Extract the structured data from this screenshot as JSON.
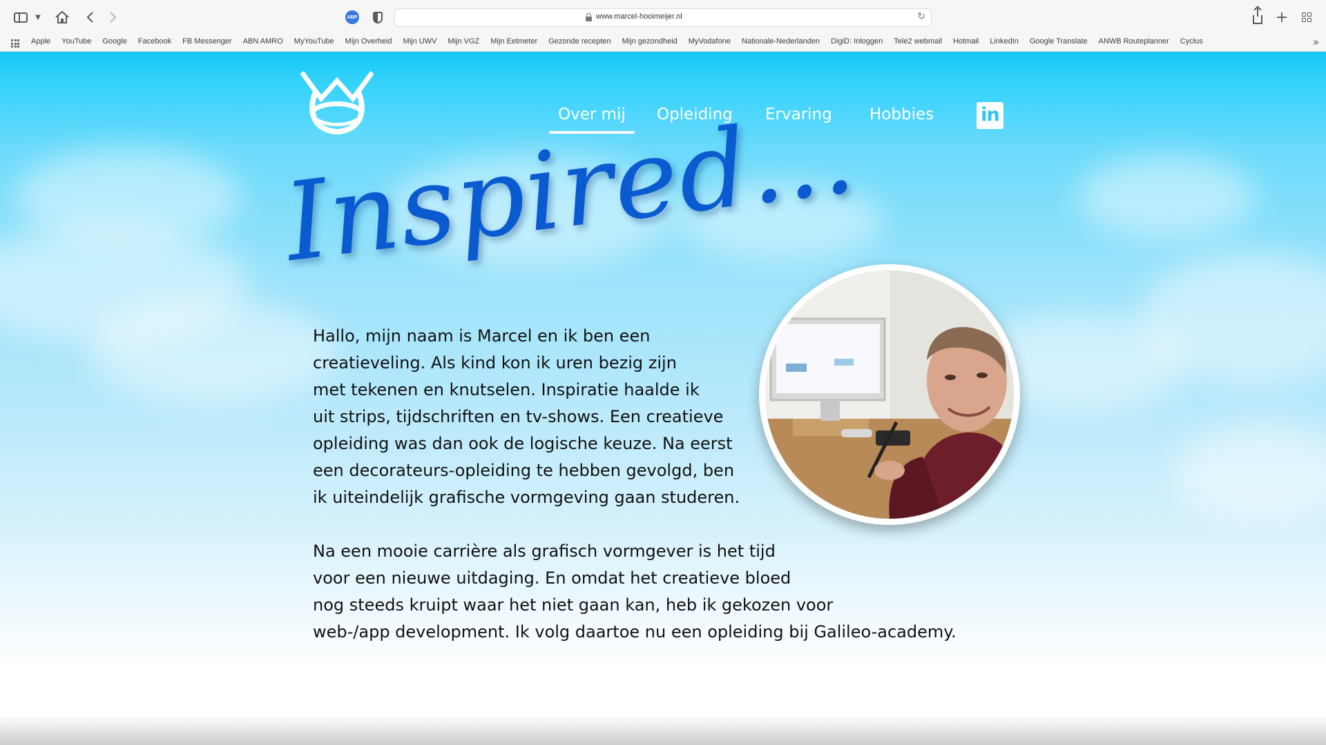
{
  "browser": {
    "url": "www.marcel-hooimeijer.nl",
    "abp_label": "ABP",
    "bookmarks": [
      "Apple",
      "YouTube",
      "Google",
      "Facebook",
      "FB Messenger",
      "ABN AMRO",
      "MyYouTube",
      "Mijn Overheid",
      "Mijn UWV",
      "Mijn VGZ",
      "Mijn Eetmeter",
      "Gezonde recepten",
      "Mijn gezondheid",
      "MyVodafone",
      "Nationale-Nederlanden",
      "DigiD: Inloggen",
      "Tele2 webmail",
      "Hotmail",
      "LinkedIn",
      "Google Translate",
      "ANWB Routeplanner",
      "Cyclus"
    ],
    "icons": [
      "sidebar-icon",
      "chevron-down-icon",
      "home-icon",
      "back-icon",
      "forward-icon",
      "adblock-icon",
      "shield-icon",
      "lock-icon",
      "reload-icon",
      "share-icon",
      "plus-icon",
      "tab-overview-icon",
      "bookmarks-grid-icon",
      "chevron-double-right-icon"
    ]
  },
  "site": {
    "nav": {
      "items": [
        {
          "label": "Over mij",
          "active": true
        },
        {
          "label": "Opleiding",
          "active": false
        },
        {
          "label": "Ervaring",
          "active": false
        },
        {
          "label": "Hobbies",
          "active": false
        }
      ],
      "linkedin_label": "in"
    },
    "headline": "Inspired...",
    "bio": {
      "paragraph1": "Hallo, mijn naam is Marcel en ik  ben een\ncreatieveling. Als kind kon ik uren bezig zijn\nmet tekenen en knutselen. Inspiratie haalde ik\nuit strips, tijdschriften en tv-shows. Een creatieve\nopleiding was dan ook de logische keuze. Na eerst\neen decorateurs-opleiding te hebben gevolgd, ben\nik uiteindelijk grafische vormgeving gaan studeren.",
      "paragraph2": "Na een mooie carrière als grafisch vormgever is het tijd\nvoor een nieuwe uitdaging.  En omdat het creatieve bloed\nnog steeds kruipt waar het niet gaan kan, heb ik gekozen voor\nweb-/app development. Ik volg daartoe nu een opleiding bij Galileo-academy."
    },
    "colors": {
      "sky_top": "#16c7f6",
      "headline": "#0a5ad0",
      "nav_text": "#ffffff",
      "body_text": "#111111"
    }
  }
}
